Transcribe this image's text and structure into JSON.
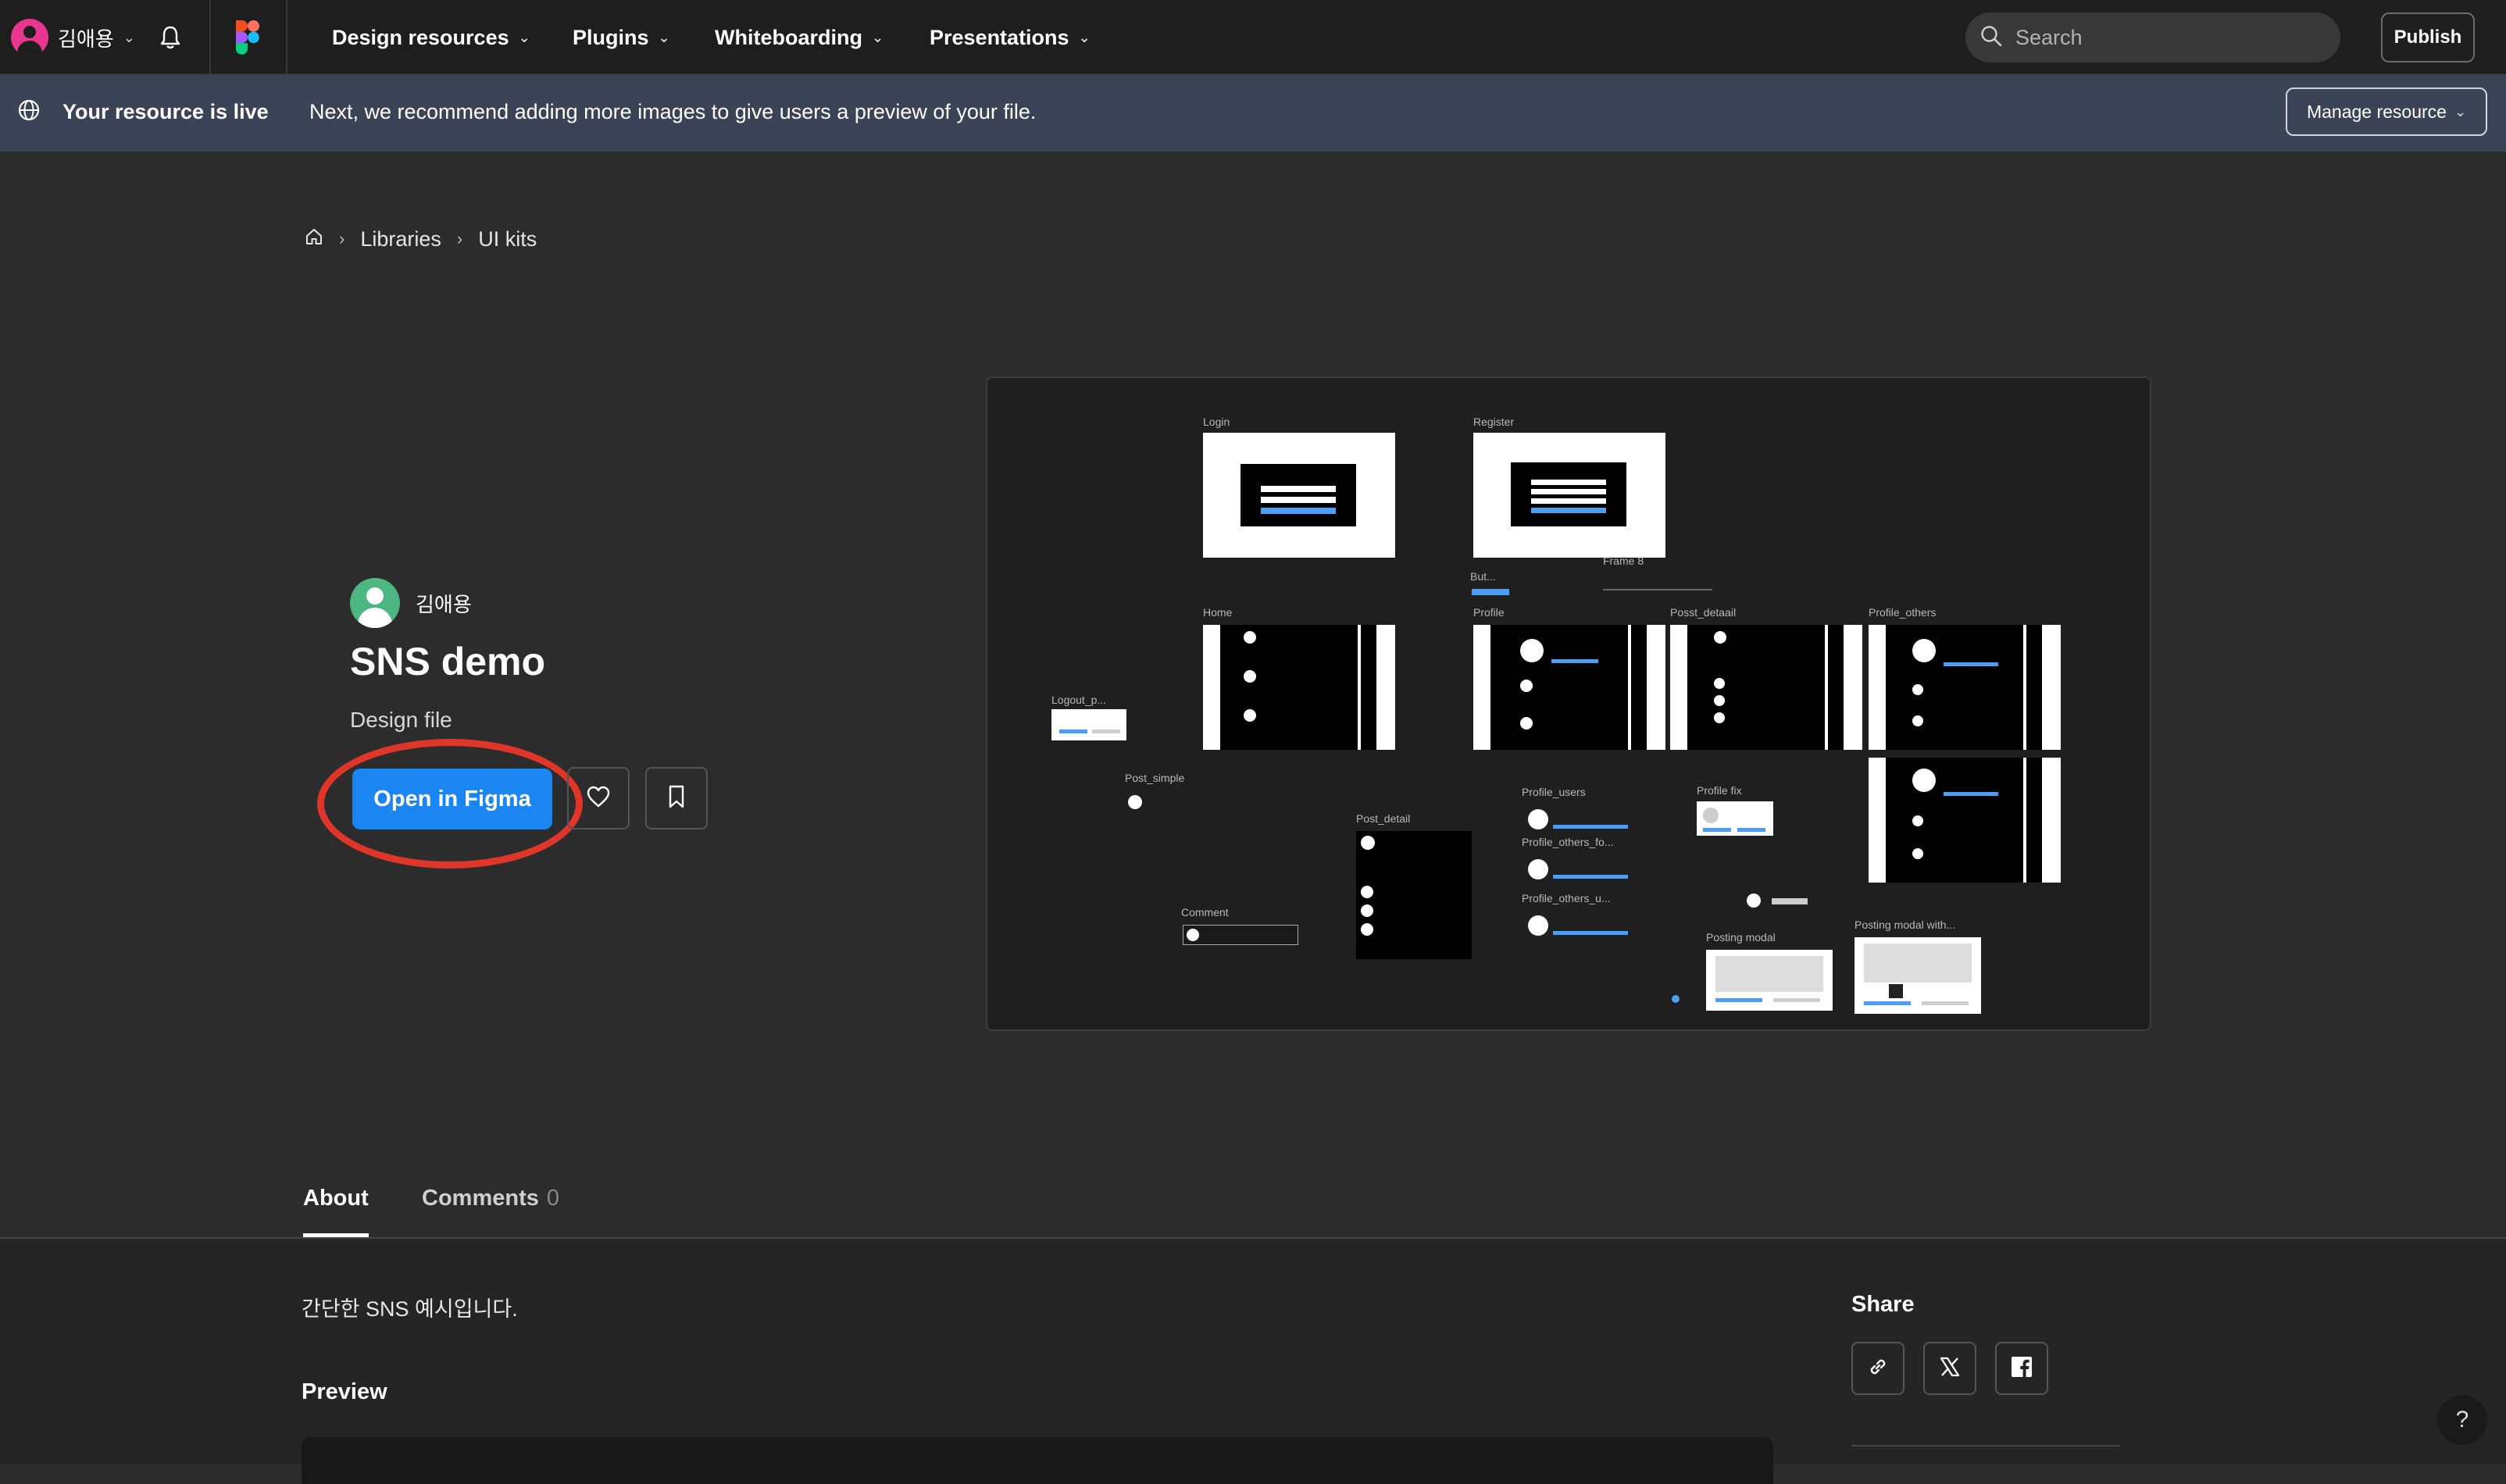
{
  "topnav": {
    "user_name": "김애용",
    "menu_items": [
      {
        "label": "Design resources"
      },
      {
        "label": "Plugins"
      },
      {
        "label": "Whiteboarding"
      },
      {
        "label": "Presentations"
      }
    ],
    "search_placeholder": "Search",
    "publish_label": "Publish"
  },
  "banner": {
    "title": "Your resource is live",
    "message": "Next, we recommend adding more images to give users a preview of your file.",
    "manage_label": "Manage resource"
  },
  "breadcrumb": {
    "items": [
      "Libraries",
      "UI kits"
    ]
  },
  "resource": {
    "author": "김애용",
    "title": "SNS demo",
    "type": "Design file",
    "open_label": "Open in Figma"
  },
  "thumbnail": {
    "frames": {
      "login": "Login",
      "register": "Register",
      "but": "But...",
      "frame8": "Frame 8",
      "home": "Home",
      "profile": "Profile",
      "posst_detaail": "Posst_detaail",
      "profile_others": "Profile_others",
      "logout": "Logout_p...",
      "post_simple": "Post_simple",
      "post_detail": "Post_detail",
      "profile_users": "Profile_users",
      "profile_others_fo": "Profile_others_fo...",
      "profile_others_u": "Profile_others_u...",
      "profile_fix": "Profile fix",
      "comment": "Comment",
      "posting_modal": "Posting modal",
      "posting_modal_with": "Posting modal with..."
    }
  },
  "tabs": {
    "about": "About",
    "comments": "Comments",
    "comments_count": "0"
  },
  "about": {
    "description": "간단한 SNS 예시입니다.",
    "preview_heading": "Preview"
  },
  "share": {
    "heading": "Share"
  },
  "help": {
    "label": "?"
  },
  "colors": {
    "accent": "#1b85f2",
    "banner_bg": "#3b4456",
    "annotation": "#e0362a",
    "page_bg": "#2c2c2c"
  }
}
